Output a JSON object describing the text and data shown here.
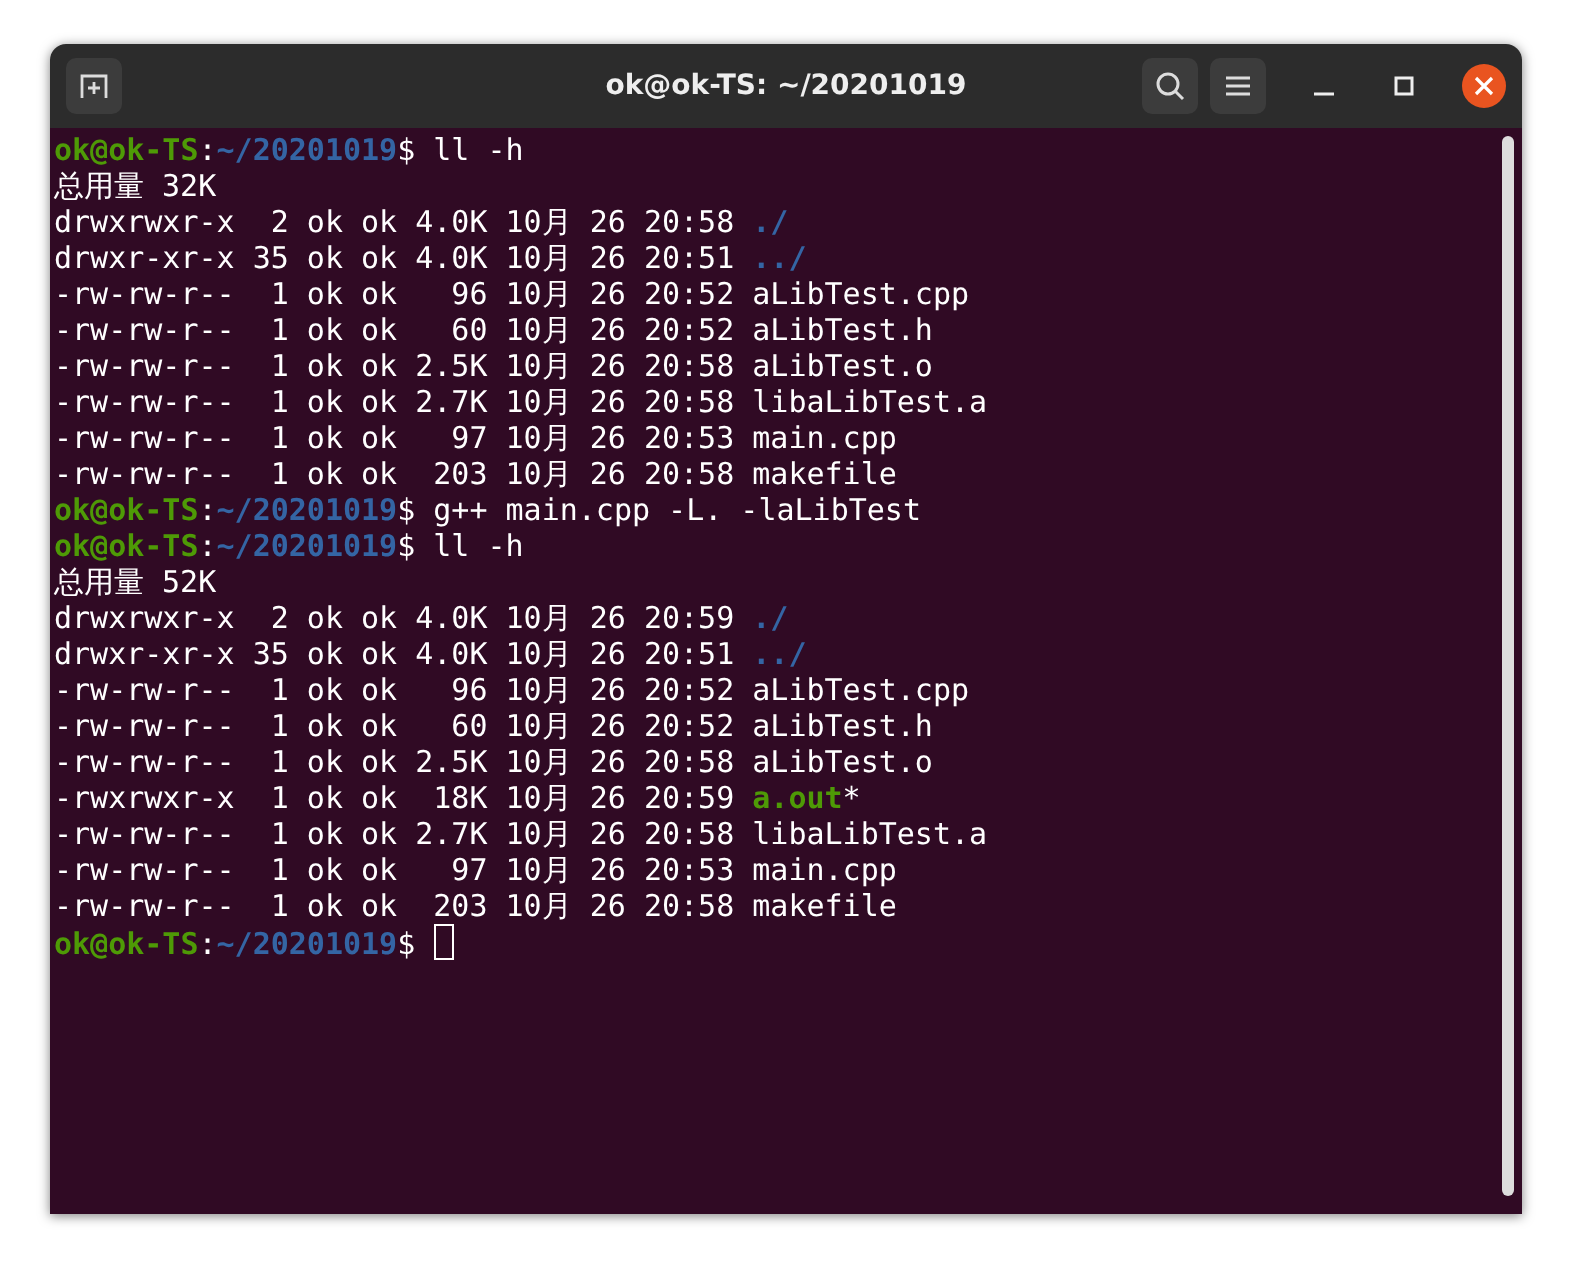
{
  "window": {
    "title": "ok@ok-TS: ~/20201019"
  },
  "terminal": {
    "cursor_visible": true,
    "lines": [
      {
        "segments": [
          {
            "kind": "user",
            "text": "ok@ok-TS"
          },
          {
            "kind": "text",
            "text": ":"
          },
          {
            "kind": "path",
            "text": "~/20201019"
          },
          {
            "kind": "text",
            "text": "$ ll -h"
          }
        ]
      },
      {
        "segments": [
          {
            "kind": "text",
            "text": "总用量 32K"
          }
        ]
      },
      {
        "segments": [
          {
            "kind": "text",
            "text": "drwxrwxr-x  2 ok ok 4.0K 10月 26 20:58 "
          },
          {
            "kind": "dir",
            "text": "./"
          }
        ]
      },
      {
        "segments": [
          {
            "kind": "text",
            "text": "drwxr-xr-x 35 ok ok 4.0K 10月 26 20:51 "
          },
          {
            "kind": "dir",
            "text": "../"
          }
        ]
      },
      {
        "segments": [
          {
            "kind": "text",
            "text": "-rw-rw-r--  1 ok ok   96 10月 26 20:52 aLibTest.cpp"
          }
        ]
      },
      {
        "segments": [
          {
            "kind": "text",
            "text": "-rw-rw-r--  1 ok ok   60 10月 26 20:52 aLibTest.h"
          }
        ]
      },
      {
        "segments": [
          {
            "kind": "text",
            "text": "-rw-rw-r--  1 ok ok 2.5K 10月 26 20:58 aLibTest.o"
          }
        ]
      },
      {
        "segments": [
          {
            "kind": "text",
            "text": "-rw-rw-r--  1 ok ok 2.7K 10月 26 20:58 libaLibTest.a"
          }
        ]
      },
      {
        "segments": [
          {
            "kind": "text",
            "text": "-rw-rw-r--  1 ok ok   97 10月 26 20:53 main.cpp"
          }
        ]
      },
      {
        "segments": [
          {
            "kind": "text",
            "text": "-rw-rw-r--  1 ok ok  203 10月 26 20:58 makefile"
          }
        ]
      },
      {
        "segments": [
          {
            "kind": "user",
            "text": "ok@ok-TS"
          },
          {
            "kind": "text",
            "text": ":"
          },
          {
            "kind": "path",
            "text": "~/20201019"
          },
          {
            "kind": "text",
            "text": "$ g++ main.cpp -L. -laLibTest"
          }
        ]
      },
      {
        "segments": [
          {
            "kind": "user",
            "text": "ok@ok-TS"
          },
          {
            "kind": "text",
            "text": ":"
          },
          {
            "kind": "path",
            "text": "~/20201019"
          },
          {
            "kind": "text",
            "text": "$ ll -h"
          }
        ]
      },
      {
        "segments": [
          {
            "kind": "text",
            "text": "总用量 52K"
          }
        ]
      },
      {
        "segments": [
          {
            "kind": "text",
            "text": "drwxrwxr-x  2 ok ok 4.0K 10月 26 20:59 "
          },
          {
            "kind": "dir",
            "text": "./"
          }
        ]
      },
      {
        "segments": [
          {
            "kind": "text",
            "text": "drwxr-xr-x 35 ok ok 4.0K 10月 26 20:51 "
          },
          {
            "kind": "dir",
            "text": "../"
          }
        ]
      },
      {
        "segments": [
          {
            "kind": "text",
            "text": "-rw-rw-r--  1 ok ok   96 10月 26 20:52 aLibTest.cpp"
          }
        ]
      },
      {
        "segments": [
          {
            "kind": "text",
            "text": "-rw-rw-r--  1 ok ok   60 10月 26 20:52 aLibTest.h"
          }
        ]
      },
      {
        "segments": [
          {
            "kind": "text",
            "text": "-rw-rw-r--  1 ok ok 2.5K 10月 26 20:58 aLibTest.o"
          }
        ]
      },
      {
        "segments": [
          {
            "kind": "text",
            "text": "-rwxrwxr-x  1 ok ok  18K 10月 26 20:59 "
          },
          {
            "kind": "exec",
            "text": "a.out"
          },
          {
            "kind": "text",
            "text": "*"
          }
        ]
      },
      {
        "segments": [
          {
            "kind": "text",
            "text": "-rw-rw-r--  1 ok ok 2.7K 10月 26 20:58 libaLibTest.a"
          }
        ]
      },
      {
        "segments": [
          {
            "kind": "text",
            "text": "-rw-rw-r--  1 ok ok   97 10月 26 20:53 main.cpp"
          }
        ]
      },
      {
        "segments": [
          {
            "kind": "text",
            "text": "-rw-rw-r--  1 ok ok  203 10月 26 20:58 makefile"
          }
        ]
      },
      {
        "segments": [
          {
            "kind": "user",
            "text": "ok@ok-TS"
          },
          {
            "kind": "text",
            "text": ":"
          },
          {
            "kind": "path",
            "text": "~/20201019"
          },
          {
            "kind": "text",
            "text": "$ "
          }
        ]
      }
    ]
  }
}
